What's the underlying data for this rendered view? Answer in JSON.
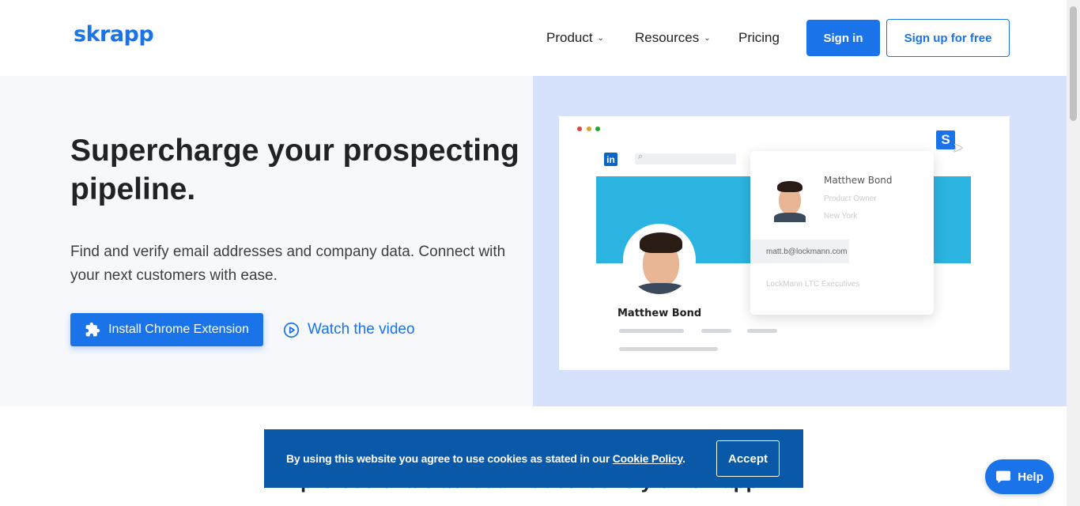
{
  "header": {
    "logo": "skrapp",
    "nav": [
      {
        "label": "Product",
        "has_dropdown": true
      },
      {
        "label": "Resources",
        "has_dropdown": true
      },
      {
        "label": "Pricing",
        "has_dropdown": false
      }
    ],
    "signin_label": "Sign in",
    "signup_label": "Sign up for free"
  },
  "hero": {
    "headline": "Supercharge your prospecting pipeline.",
    "subtext": "Find and verify email addresses and company data. Connect with your next customers with ease.",
    "install_label": "Install Chrome Extension",
    "watch_label": "Watch the video"
  },
  "mock": {
    "profile_name": "Matthew Bond",
    "popup": {
      "name": "Matthew Bond",
      "role": "Product Owner",
      "location": "New York",
      "email": "matt.b@lockmann.com",
      "company": "LockMann LTC Executives"
    },
    "linkedin_icon": "in",
    "skrapp_icon": "S"
  },
  "cookie": {
    "text": "By using this website you agree to use cookies as stated in our ",
    "link": "Cookie Policy",
    "suffix": ".",
    "accept_label": "Accept"
  },
  "behind_banner_text": "professionals across industries rely on Skrapp",
  "help_label": "Help",
  "colors": {
    "brand": "#1a73e8",
    "cookie_bg": "#0a58a8",
    "hero_left_bg": "#f6f8fc",
    "hero_right_bg": "#d6e2fc"
  }
}
